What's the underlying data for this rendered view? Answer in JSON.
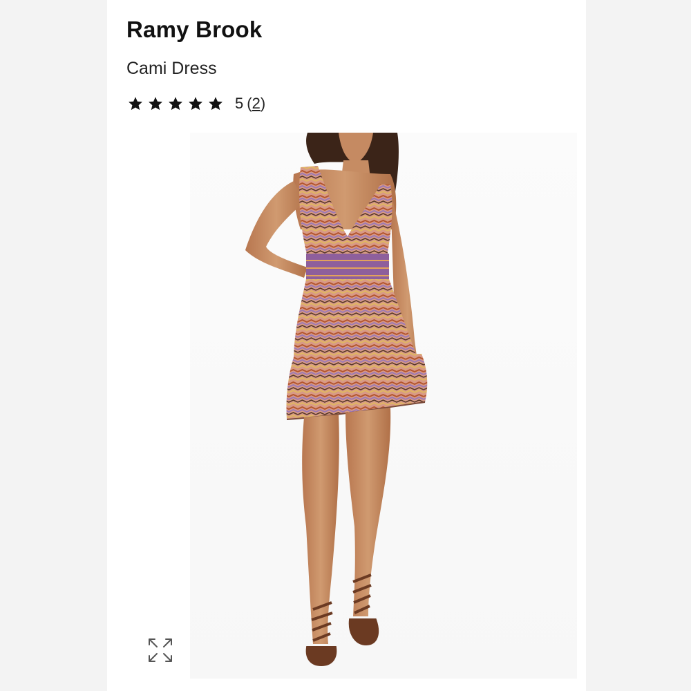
{
  "product": {
    "brand": "Ramy Brook",
    "name": "Cami Dress"
  },
  "rating": {
    "value": "5",
    "count_open": "(",
    "count": "2",
    "count_close": ")",
    "stars_filled": 5,
    "stars_total": 5
  },
  "icons": {
    "star": "star-icon",
    "expand": "expand-arrows-icon"
  },
  "colors": {
    "text": "#111111",
    "dress_orange": "#c86a3e",
    "dress_purple": "#9a6aa6",
    "skin": "#c98a5e"
  }
}
